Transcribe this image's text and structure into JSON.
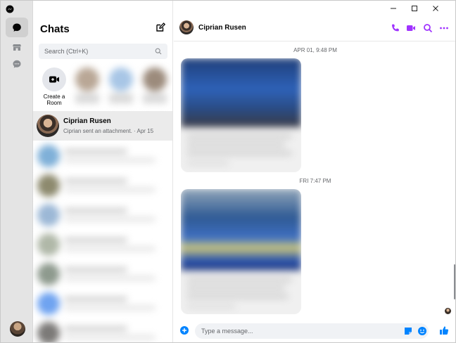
{
  "app": {
    "title": "Messenger"
  },
  "rail": {
    "items": [
      "chats-icon",
      "marketplace-icon",
      "message-requests-icon"
    ]
  },
  "sidebar": {
    "title": "Chats",
    "search_placeholder": "Search (Ctrl+K)",
    "create_room_label": "Create a Room",
    "active_conversation": {
      "name": "Ciprian Rusen",
      "preview": "Ciprian sent an attachment. · Apr 15"
    }
  },
  "conversation": {
    "name": "Ciprian Rusen",
    "timestamps": [
      "APR 01, 9:48 PM",
      "FRI 7:47 PM"
    ],
    "composer_placeholder": "Type a message..."
  },
  "colors": {
    "accent": "#a033ff",
    "messenger_blue": "#0084ff",
    "selected_row": "#ebebeb"
  }
}
